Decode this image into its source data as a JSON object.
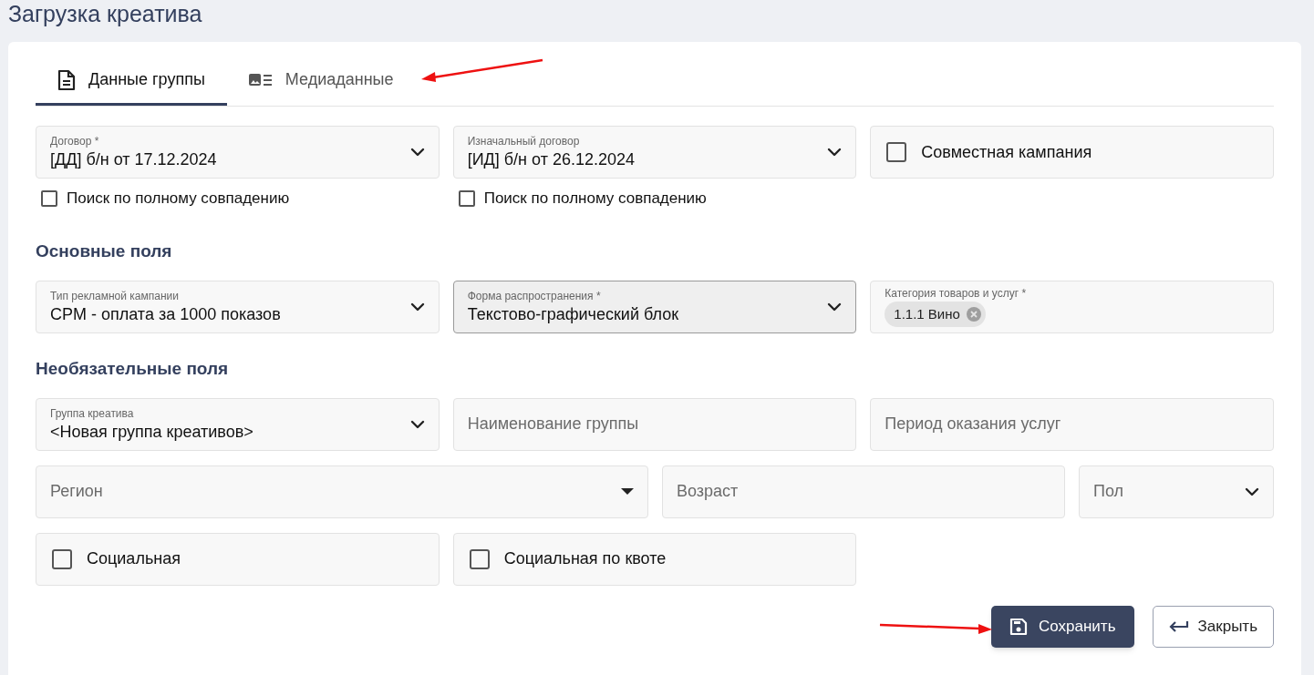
{
  "page_title": "Загрузка креатива",
  "tabs": [
    {
      "label": "Данные группы",
      "selected": true
    },
    {
      "label": "Медиаданные",
      "selected": false
    }
  ],
  "contract_fields": [
    {
      "kind": "select",
      "label": "Договор *",
      "value": "[ДД] б/н от 17.12.2024",
      "active": false,
      "exact_search": {
        "label": "Поиск по полному совпадению",
        "checked": false
      }
    },
    {
      "kind": "select",
      "label": "Изначальный договор",
      "value": "[ИД] б/н от 26.12.2024",
      "active": false,
      "exact_search": {
        "label": "Поиск по полному совпадению",
        "checked": false
      }
    },
    {
      "kind": "checkbox",
      "label": "Совместная кампания",
      "checked": false
    }
  ],
  "sections": [
    {
      "title": "Основные поля",
      "rows": [
        [
          {
            "kind": "select",
            "label": "Тип рекламной кампании",
            "value": "CPM - оплата за 1000 показов",
            "active": false
          },
          {
            "kind": "select",
            "label": "Форма распространения *",
            "value": "Текстово-графический блок",
            "active": true
          },
          {
            "kind": "chips",
            "label": "Категория товаров и услуг *",
            "chips": [
              "1.1.1 Вино"
            ],
            "active": false
          }
        ]
      ]
    },
    {
      "title": "Необязательные поля",
      "rows": [
        [
          {
            "kind": "select",
            "label": "Группа креатива",
            "value": "<Новая группа креативов>",
            "active": false
          },
          {
            "kind": "input",
            "placeholder": "Наименование группы",
            "active": false
          },
          {
            "kind": "input",
            "placeholder": "Период оказания услуг",
            "active": false
          }
        ],
        [
          {
            "kind": "combo",
            "placeholder": "Регион",
            "active": false
          },
          {
            "kind": "input",
            "placeholder": "Возраст",
            "active": false
          },
          {
            "kind": "select",
            "placeholder": "Пол",
            "active": false
          }
        ],
        [
          {
            "kind": "checkbox",
            "label": "Социальная",
            "checked": false
          },
          {
            "kind": "checkbox",
            "label": "Социальная по квоте",
            "checked": false
          }
        ]
      ]
    }
  ],
  "buttons": [
    {
      "kind": "primary",
      "label": "Сохранить"
    },
    {
      "kind": "outline",
      "label": "Закрыть"
    }
  ]
}
